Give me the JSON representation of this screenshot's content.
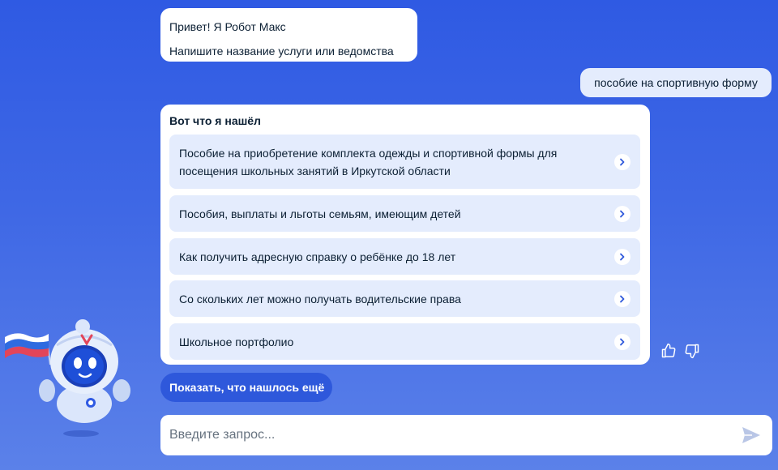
{
  "chat": {
    "bot_greeting": [
      "Привет! Я Робот Макс",
      "Напишите название услуги или ведомства"
    ],
    "user_message": "пособие на спортивную форму",
    "results_title": "Вот что я нашёл",
    "results": [
      {
        "label": "Пособие на приобретение комплекта одежды и спортивной формы для посещения школьных занятий в Иркутской области"
      },
      {
        "label": "Пособия, выплаты и льготы семьям, имеющим детей"
      },
      {
        "label": "Как получить адресную справку о ребёнке до 18 лет"
      },
      {
        "label": "Со скольких лет можно получать водительские права"
      },
      {
        "label": "Школьное портфолио"
      }
    ],
    "show_more_label": "Показать, что нашлось ещё"
  },
  "feedback": {
    "like_icon": "thumbs-up-icon",
    "dislike_icon": "thumbs-down-icon"
  },
  "input": {
    "placeholder": "Введите запрос...",
    "value": "",
    "send_icon": "send-icon"
  },
  "mascot": {
    "name": "robot-max-mascot",
    "flag": "russian-flag"
  },
  "colors": {
    "background_top": "#2f5ae3",
    "background_bottom": "#5b81e9",
    "bubble": "#ffffff",
    "user_bubble": "#e4ecfd",
    "result_item": "#e4ecfd",
    "primary_button": "#2e58db",
    "text": "#0b1f33",
    "placeholder": "#66727f",
    "chevron": "#2e58db"
  }
}
